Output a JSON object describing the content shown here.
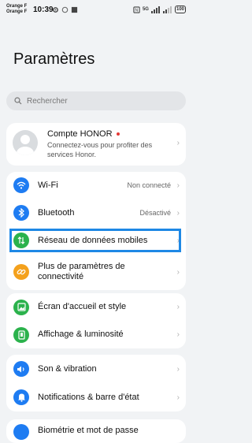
{
  "status": {
    "carrier1": "Orange F",
    "carrier2": "Orange F",
    "time": "10:39",
    "network": "5G",
    "battery": "100"
  },
  "header": {
    "title": "Paramètres"
  },
  "search": {
    "placeholder": "Rechercher"
  },
  "account": {
    "name": "Compte HONOR",
    "subtitle": "Connectez-vous pour profiter des services Honor."
  },
  "network_group": [
    {
      "label": "Wi-Fi",
      "value": "Non connecté",
      "icon": "wifi-icon",
      "color": "#1e7cf2"
    },
    {
      "label": "Bluetooth",
      "value": "Désactivé",
      "icon": "bluetooth-icon",
      "color": "#1e7cf2"
    },
    {
      "label": "Réseau de données mobiles",
      "value": "",
      "icon": "mobile-data-icon",
      "color": "#2bb24c"
    },
    {
      "label": "Plus de paramètres de connectivité",
      "value": "",
      "icon": "link-icon",
      "color": "#f4a11c"
    }
  ],
  "display_group": [
    {
      "label": "Écran d'accueil et style",
      "icon": "image-icon",
      "color": "#2bb24c"
    },
    {
      "label": "Affichage & luminosité",
      "icon": "phone-display-icon",
      "color": "#2bb24c"
    }
  ],
  "sound_group": [
    {
      "label": "Son & vibration",
      "icon": "speaker-icon",
      "color": "#1e7cf2"
    },
    {
      "label": "Notifications & barre d'état",
      "icon": "bell-icon",
      "color": "#1e7cf2"
    }
  ],
  "partial_row": {
    "label": "Biométrie et mot de passe"
  },
  "colors": {
    "accent": "#1e88e5",
    "background": "#f1f3f5"
  }
}
